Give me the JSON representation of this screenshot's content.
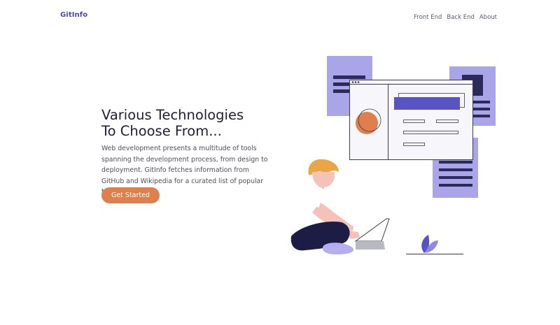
{
  "header": {
    "brand": "GitInfo",
    "nav": [
      {
        "label": "Front End"
      },
      {
        "label": "Back End"
      },
      {
        "label": "About"
      }
    ]
  },
  "hero": {
    "title_line1": "Various Technologies",
    "title_line2": "To Choose From...",
    "description": "Web development presents a multitude of tools spanning the development process, from design to deployment. GitInfo fetches information from GitHub and Wikipedia for a curated list of popular tools.",
    "cta_label": "Get Started"
  },
  "colors": {
    "brand": "#4b46b0",
    "accent": "#e07f4e",
    "illustration_purple": "#aaa5e8",
    "illustration_dark": "#2c2a5a",
    "illustration_blue": "#5a53c6"
  },
  "illustration": {
    "name": "developer-with-laptop-illustration"
  }
}
